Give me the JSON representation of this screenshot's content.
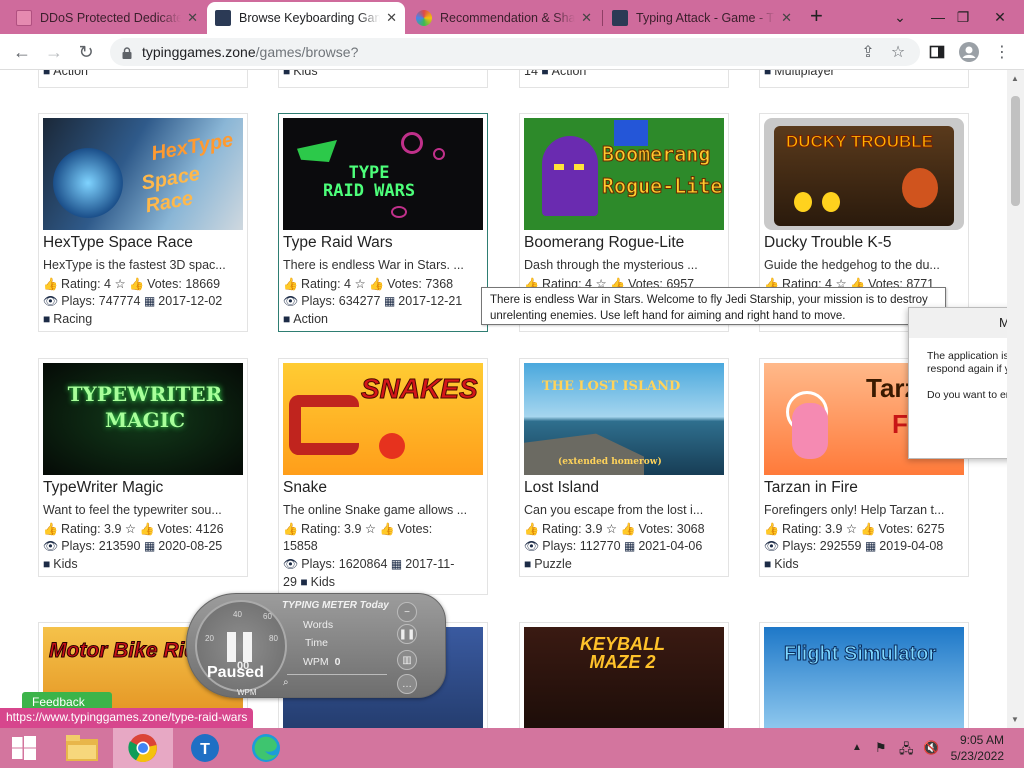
{
  "browser": {
    "tabs": [
      {
        "title": "DDoS Protected Dedicated",
        "active": false
      },
      {
        "title": "Browse Keyboarding Games",
        "active": true
      },
      {
        "title": "Recommendation & Sha",
        "active": false
      },
      {
        "title": "Typing Attack - Game - T",
        "active": false
      }
    ],
    "url_host": "typinggames.zone",
    "url_path": "/games/browse?"
  },
  "top_stubs": [
    {
      "text": "Action"
    },
    {
      "text": "Kids"
    },
    {
      "text": "14 ",
      "tag": "Action"
    },
    {
      "text": "Multiplayer"
    }
  ],
  "games": [
    {
      "title": "HexType Space Race",
      "desc": "HexType is the fastest 3D spac...",
      "rating": "Rating: 4",
      "votes": "Votes: 18669",
      "plays": "Plays: 747774",
      "date": "2017-12-02",
      "category": "Racing",
      "art": "HexType Space Race"
    },
    {
      "title": "Type Raid Wars",
      "desc": "There is endless War in Stars. ...",
      "rating": "Rating: 4",
      "votes": "Votes: 7368",
      "plays": "Plays: 634277",
      "date": "2017-12-21",
      "category": "Action",
      "art": "TYPE RAID WARS"
    },
    {
      "title": "Boomerang Rogue-Lite",
      "desc": "Dash through the mysterious ...",
      "rating": "Rating: 4",
      "votes": "Votes: 6957",
      "plays": "",
      "date": "",
      "category": "",
      "art": "Boomerang Rogue-Lite"
    },
    {
      "title": "Ducky Trouble K-5",
      "desc": "Guide the hedgehog to the du...",
      "rating": "Rating: 4",
      "votes": "Votes: 8771",
      "plays": "",
      "date": "",
      "category": "",
      "art": "DUCKY TROUBLE"
    },
    {
      "title": "TypeWriter Magic",
      "desc": "Want to feel the typewriter sou...",
      "rating": "Rating: 3.9",
      "votes": "Votes: 4126",
      "plays": "Plays: 213590",
      "date": "2020-08-25",
      "category": "Kids",
      "art": "TYPEWRITER MAGIC"
    },
    {
      "title": "Snake",
      "desc": "The online Snake game allows ...",
      "rating": "Rating: 3.9",
      "votes": "Votes:",
      "votes2": "15858",
      "plays": "Plays: 1620864",
      "date": "2017-11-",
      "date2": "29",
      "category": "Kids",
      "art": "SNAKES"
    },
    {
      "title": "Lost Island",
      "desc": "Can you escape from the lost i...",
      "rating": "Rating: 3.9",
      "votes": "Votes: 3068",
      "plays": "Plays: 112770",
      "date": "2021-04-06",
      "category": "Puzzle",
      "art": "THE LOST ISLAND",
      "art_sub": "(extended homerow)"
    },
    {
      "title": "Tarzan in Fire",
      "desc": "Forefingers only! Help Tarzan t...",
      "rating": "Rating: 3.9",
      "votes": "Votes: 6275",
      "plays": "Plays: 292559",
      "date": "2019-04-08",
      "category": "Kids",
      "art": "Tarzan FIR"
    },
    {
      "art": "Motor Bike Ride"
    },
    {
      "art": ""
    },
    {
      "art": "KEYBALL MAZE 2"
    },
    {
      "art": "Flight Simulator"
    }
  ],
  "tooltip": "There is endless War in Stars. Welcome to fly Jedi Starship, your mission is to destroy unrelenting enemies. Use left hand for aiming and right hand to move.",
  "dialog": {
    "title": "Micr",
    "line1": "The application is no",
    "line2": "respond again if you",
    "line3": "Do you want to end"
  },
  "meter": {
    "title": "TYPING METER Today",
    "words_label": "Words",
    "time_label": "Time",
    "wpm_label": "WPM",
    "wpm_value": "0",
    "gauge_value": "00",
    "status": "Paused",
    "gauge_unit": "WPM",
    "ticks": [
      "20",
      "40",
      "60",
      "80"
    ]
  },
  "feedback": "Feedback",
  "status_url": "https://www.typinggames.zone/type-raid-wars",
  "clock": {
    "time": "9:05 AM",
    "date": "5/23/2022"
  }
}
